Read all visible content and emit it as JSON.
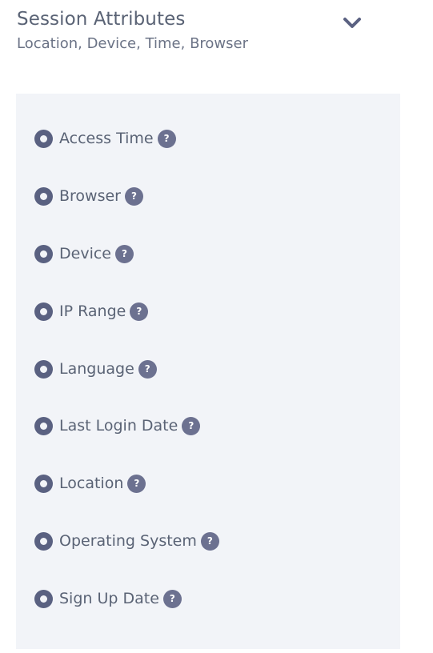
{
  "section": {
    "title": "Session Attributes",
    "subtitle": "Location, Device, Time, Browser",
    "toggle_icon": "chevron-down-icon"
  },
  "options": [
    {
      "label": "Access Time",
      "help": "?"
    },
    {
      "label": "Browser",
      "help": "?"
    },
    {
      "label": "Device",
      "help": "?"
    },
    {
      "label": "IP Range",
      "help": "?"
    },
    {
      "label": "Language",
      "help": "?"
    },
    {
      "label": "Last Login Date",
      "help": "?"
    },
    {
      "label": "Location",
      "help": "?"
    },
    {
      "label": "Operating System",
      "help": "?"
    },
    {
      "label": "Sign Up Date",
      "help": "?"
    }
  ],
  "colors": {
    "text": "#5a6375",
    "radio": "#5a6181",
    "help_badge": "#6c7190",
    "panel_bg": "#f2f4f8"
  }
}
